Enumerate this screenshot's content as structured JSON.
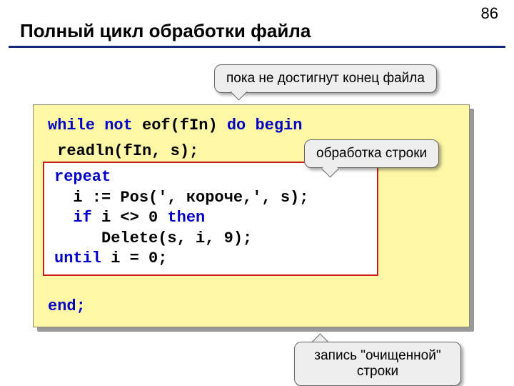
{
  "page_number": "86",
  "title": "Полный цикл обработки файла",
  "callouts": {
    "eof_note": "пока не достигнут конец файла",
    "process_note": "обработка строки",
    "write_note": "запись \"очищенной\" строки"
  },
  "code": {
    "l1_a": "while not",
    "l1_b": " eof(fIn) ",
    "l1_c": "do begin",
    "l2": " readln(fIn, s);",
    "inner": {
      "r1": "repeat",
      "r2": "  i := Pos(', короче,', s);",
      "r3_a": "  ",
      "r3_b": "if",
      "r3_c": " i <> 0 ",
      "r3_d": "then",
      "r4": "     Delete(s, i, 9);",
      "r5_a": "until",
      "r5_b": " i = 0;"
    },
    "l3": "end;"
  }
}
